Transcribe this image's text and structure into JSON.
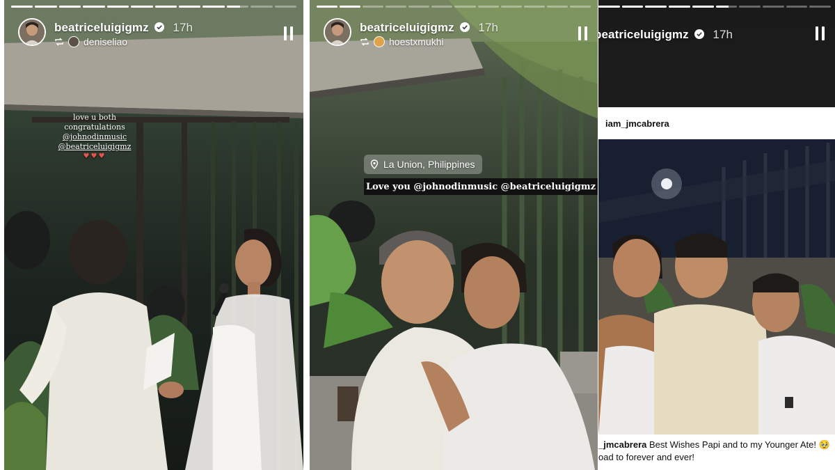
{
  "stories": [
    {
      "username": "beatriceluigigmz",
      "time": "17h",
      "repost_user": "deniseliao",
      "progress": [
        1,
        1,
        1,
        1,
        1,
        1,
        1,
        1,
        1,
        0.6,
        0,
        0
      ],
      "stickers": {
        "line1": "love u both",
        "line2": "congratulations",
        "mention1": "@johnodinmusic",
        "mention2": "@beatriceluigigmz"
      }
    },
    {
      "username": "beatriceluigigmz",
      "time": "17h",
      "repost_user": "hoestxmukhi",
      "progress": [
        1,
        1,
        0,
        0,
        0,
        0,
        0,
        0,
        0,
        0,
        0,
        0
      ],
      "location": "La Union, Philippines",
      "caption": "Love you @johnodinmusic @beatriceluigigmz"
    },
    {
      "username": "beatriceluigigmz",
      "time": "17h",
      "progress": [
        1,
        1,
        1,
        1,
        1,
        0.6,
        0,
        0,
        0,
        0
      ],
      "post_author": "iam_jmcabrera",
      "post_caption_user": "_jmcabrera",
      "post_caption_text": "Best Wishes Papi and to my Younger Ate! 🥹",
      "post_caption_line2": "oad to forever and ever!"
    }
  ],
  "colors": {
    "progress_fill": "#ffffff",
    "progress_track": "rgba(255,255,255,0.35)",
    "caption_bg": "#111111"
  },
  "icons": [
    "verified-icon",
    "repost-icon",
    "pause-icon",
    "location-pin-icon"
  ]
}
